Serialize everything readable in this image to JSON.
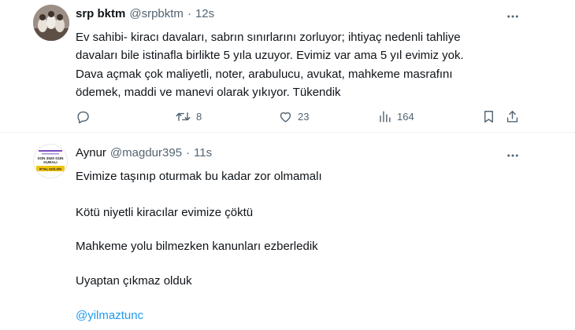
{
  "tweet1": {
    "display_name": "srp bktm",
    "handle": "@srpbktm",
    "separator": "·",
    "time": "12s",
    "text_lines": [
      "Ev sahibi- kiracı davaları, sabrın sınırlarını zorluyor; ihtiyaç nedenli tahliye",
      "davaları bile istinafla birlikte 5 yıla uzuyor. Evimiz var ama 5 yıl evimiz yok.",
      "Dava açmak çok maliyetli, noter, arabulucu, avukat, mahkeme masrafını",
      "ödemek, maddi ve manevi olarak yıkıyor. Tükendik"
    ],
    "actions": {
      "reply_count": "",
      "retweet_count": "8",
      "like_count": "23",
      "views_count": "164"
    }
  },
  "tweet2": {
    "display_name": "Aynur",
    "handle": "@magdur395",
    "separator": "·",
    "time": "11s",
    "avatar_text": [
      "SON 3520 GÜN",
      "KURALI",
      "İPTAL EDİLSİN"
    ],
    "paragraphs": [
      "Evimize taşınıp oturmak bu kadar zor olmamalı",
      "Kötü niyetli kiracılar evimize çöktü",
      "Mahkeme yolu bilmezken kanunları ezberledik",
      "Uyaptan çıkmaz olduk"
    ],
    "mention": "@yilmaztunc"
  },
  "icons": {
    "more": "more-icon",
    "reply": "reply-icon",
    "retweet": "retweet-icon",
    "like": "heart-icon",
    "views": "views-icon",
    "bookmark": "bookmark-icon",
    "share": "share-icon"
  },
  "colors": {
    "text": "#0f1419",
    "secondary": "#536471",
    "link": "#1d9bf0",
    "divider": "#eff3f4"
  }
}
